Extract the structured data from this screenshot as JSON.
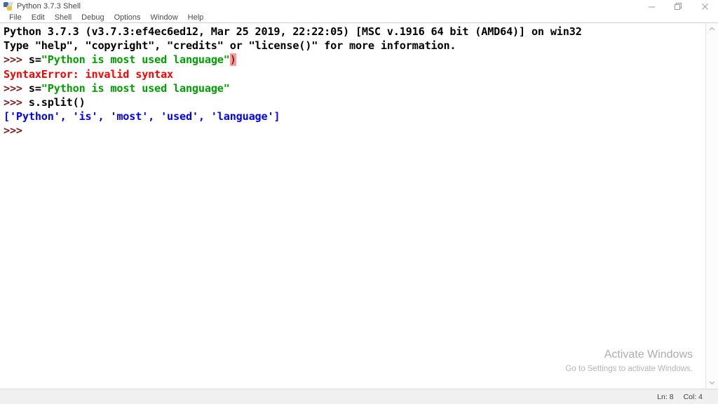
{
  "window": {
    "title": "Python 3.7.3 Shell",
    "icon": "python-idle-icon",
    "controls": [
      {
        "name": "minimize-button",
        "glyph": "minimize"
      },
      {
        "name": "maximize-button",
        "glyph": "restore"
      },
      {
        "name": "close-button",
        "glyph": "close"
      }
    ]
  },
  "menubar": {
    "items": [
      {
        "label": "File"
      },
      {
        "label": "Edit"
      },
      {
        "label": "Shell"
      },
      {
        "label": "Debug"
      },
      {
        "label": "Options"
      },
      {
        "label": "Window"
      },
      {
        "label": "Help"
      }
    ]
  },
  "shell": {
    "lines": [
      {
        "id": "banner-version",
        "segments": [
          {
            "text": "Python 3.7.3 (v3.7.3:ef4ec6ed12, Mar 25 2019, 22:22:05) [MSC v.1916 64 bit (AMD64)] on win32",
            "style": "black"
          }
        ]
      },
      {
        "id": "banner-help",
        "segments": [
          {
            "text": "Type \"help\", \"copyright\", \"credits\" or \"license()\" for more information.",
            "style": "black"
          }
        ]
      },
      {
        "id": "input-assign-error",
        "segments": [
          {
            "text": ">>> ",
            "style": "prompt"
          },
          {
            "text": "s=",
            "style": "black"
          },
          {
            "text": "\"Python is most used language\"",
            "style": "string"
          },
          {
            "text": ")",
            "style": "highlight"
          }
        ]
      },
      {
        "id": "syntax-error",
        "segments": [
          {
            "text": "SyntaxError: invalid syntax",
            "style": "error"
          }
        ]
      },
      {
        "id": "input-assign-ok",
        "segments": [
          {
            "text": ">>> ",
            "style": "prompt"
          },
          {
            "text": "s=",
            "style": "black"
          },
          {
            "text": "\"Python is most used language\"",
            "style": "string"
          }
        ]
      },
      {
        "id": "input-split",
        "segments": [
          {
            "text": ">>> ",
            "style": "prompt"
          },
          {
            "text": "s.split()",
            "style": "black"
          }
        ]
      },
      {
        "id": "output-split",
        "segments": [
          {
            "text": "['Python', 'is', 'most', 'used', 'language']",
            "style": "output"
          }
        ]
      },
      {
        "id": "prompt-empty",
        "segments": [
          {
            "text": ">>> ",
            "style": "prompt"
          }
        ]
      }
    ]
  },
  "watermark": {
    "title": "Activate Windows",
    "subtitle": "Go to Settings to activate Windows."
  },
  "statusbar": {
    "line": "Ln: 8",
    "column": "Col: 4"
  },
  "colors": {
    "prompt": "#7f1d1d",
    "string": "#00a000",
    "error": "#ff0000",
    "output": "#0000ff",
    "highlight_bg": "#ff9a9a",
    "text": "#000000"
  }
}
